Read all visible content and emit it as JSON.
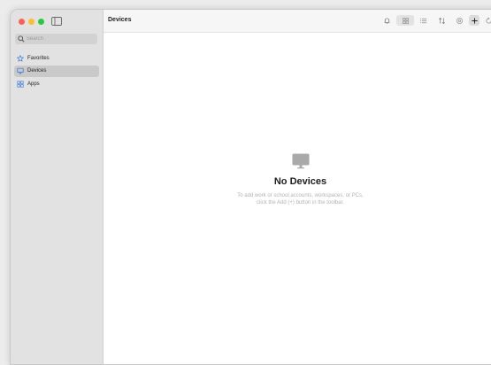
{
  "window": {
    "traffic_lights": [
      "close",
      "minimize",
      "zoom"
    ]
  },
  "sidebar": {
    "search": {
      "placeholder": "Search",
      "value": ""
    },
    "items": [
      {
        "label": "Favorites",
        "icon": "star-icon",
        "selected": false
      },
      {
        "label": "Devices",
        "icon": "monitor-icon",
        "selected": true
      },
      {
        "label": "Apps",
        "icon": "grid-icon",
        "selected": false
      }
    ]
  },
  "header": {
    "title": "Devices"
  },
  "toolbar": {
    "buttons": [
      "bell-icon",
      "tile-view-icon",
      "list-view-icon",
      "sort-icon",
      "settings-icon",
      "add-icon",
      "refresh-icon"
    ]
  },
  "empty_state": {
    "icon": "monitor-icon",
    "title": "No Devices",
    "line1": "To add work or school accounts, workspaces, or PCs,",
    "line2": "click the Add (+) button in the toolbar."
  },
  "colors": {
    "accent": "#2a6fdb",
    "close": "#ff5f57",
    "minimize": "#febc2e",
    "zoom": "#28c840"
  }
}
